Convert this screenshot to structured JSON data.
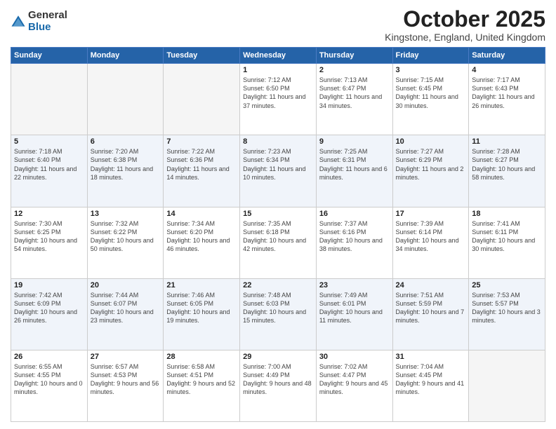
{
  "header": {
    "logo_general": "General",
    "logo_blue": "Blue",
    "title": "October 2025",
    "location": "Kingstone, England, United Kingdom"
  },
  "days_of_week": [
    "Sunday",
    "Monday",
    "Tuesday",
    "Wednesday",
    "Thursday",
    "Friday",
    "Saturday"
  ],
  "weeks": [
    [
      {
        "day": "",
        "empty": true
      },
      {
        "day": "",
        "empty": true
      },
      {
        "day": "",
        "empty": true
      },
      {
        "day": "1",
        "sunrise": "7:12 AM",
        "sunset": "6:50 PM",
        "daylight": "11 hours and 37 minutes."
      },
      {
        "day": "2",
        "sunrise": "7:13 AM",
        "sunset": "6:47 PM",
        "daylight": "11 hours and 34 minutes."
      },
      {
        "day": "3",
        "sunrise": "7:15 AM",
        "sunset": "6:45 PM",
        "daylight": "11 hours and 30 minutes."
      },
      {
        "day": "4",
        "sunrise": "7:17 AM",
        "sunset": "6:43 PM",
        "daylight": "11 hours and 26 minutes."
      }
    ],
    [
      {
        "day": "5",
        "sunrise": "7:18 AM",
        "sunset": "6:40 PM",
        "daylight": "11 hours and 22 minutes."
      },
      {
        "day": "6",
        "sunrise": "7:20 AM",
        "sunset": "6:38 PM",
        "daylight": "11 hours and 18 minutes."
      },
      {
        "day": "7",
        "sunrise": "7:22 AM",
        "sunset": "6:36 PM",
        "daylight": "11 hours and 14 minutes."
      },
      {
        "day": "8",
        "sunrise": "7:23 AM",
        "sunset": "6:34 PM",
        "daylight": "11 hours and 10 minutes."
      },
      {
        "day": "9",
        "sunrise": "7:25 AM",
        "sunset": "6:31 PM",
        "daylight": "11 hours and 6 minutes."
      },
      {
        "day": "10",
        "sunrise": "7:27 AM",
        "sunset": "6:29 PM",
        "daylight": "11 hours and 2 minutes."
      },
      {
        "day": "11",
        "sunrise": "7:28 AM",
        "sunset": "6:27 PM",
        "daylight": "10 hours and 58 minutes."
      }
    ],
    [
      {
        "day": "12",
        "sunrise": "7:30 AM",
        "sunset": "6:25 PM",
        "daylight": "10 hours and 54 minutes."
      },
      {
        "day": "13",
        "sunrise": "7:32 AM",
        "sunset": "6:22 PM",
        "daylight": "10 hours and 50 minutes."
      },
      {
        "day": "14",
        "sunrise": "7:34 AM",
        "sunset": "6:20 PM",
        "daylight": "10 hours and 46 minutes."
      },
      {
        "day": "15",
        "sunrise": "7:35 AM",
        "sunset": "6:18 PM",
        "daylight": "10 hours and 42 minutes."
      },
      {
        "day": "16",
        "sunrise": "7:37 AM",
        "sunset": "6:16 PM",
        "daylight": "10 hours and 38 minutes."
      },
      {
        "day": "17",
        "sunrise": "7:39 AM",
        "sunset": "6:14 PM",
        "daylight": "10 hours and 34 minutes."
      },
      {
        "day": "18",
        "sunrise": "7:41 AM",
        "sunset": "6:11 PM",
        "daylight": "10 hours and 30 minutes."
      }
    ],
    [
      {
        "day": "19",
        "sunrise": "7:42 AM",
        "sunset": "6:09 PM",
        "daylight": "10 hours and 26 minutes."
      },
      {
        "day": "20",
        "sunrise": "7:44 AM",
        "sunset": "6:07 PM",
        "daylight": "10 hours and 23 minutes."
      },
      {
        "day": "21",
        "sunrise": "7:46 AM",
        "sunset": "6:05 PM",
        "daylight": "10 hours and 19 minutes."
      },
      {
        "day": "22",
        "sunrise": "7:48 AM",
        "sunset": "6:03 PM",
        "daylight": "10 hours and 15 minutes."
      },
      {
        "day": "23",
        "sunrise": "7:49 AM",
        "sunset": "6:01 PM",
        "daylight": "10 hours and 11 minutes."
      },
      {
        "day": "24",
        "sunrise": "7:51 AM",
        "sunset": "5:59 PM",
        "daylight": "10 hours and 7 minutes."
      },
      {
        "day": "25",
        "sunrise": "7:53 AM",
        "sunset": "5:57 PM",
        "daylight": "10 hours and 3 minutes."
      }
    ],
    [
      {
        "day": "26",
        "sunrise": "6:55 AM",
        "sunset": "4:55 PM",
        "daylight": "10 hours and 0 minutes."
      },
      {
        "day": "27",
        "sunrise": "6:57 AM",
        "sunset": "4:53 PM",
        "daylight": "9 hours and 56 minutes."
      },
      {
        "day": "28",
        "sunrise": "6:58 AM",
        "sunset": "4:51 PM",
        "daylight": "9 hours and 52 minutes."
      },
      {
        "day": "29",
        "sunrise": "7:00 AM",
        "sunset": "4:49 PM",
        "daylight": "9 hours and 48 minutes."
      },
      {
        "day": "30",
        "sunrise": "7:02 AM",
        "sunset": "4:47 PM",
        "daylight": "9 hours and 45 minutes."
      },
      {
        "day": "31",
        "sunrise": "7:04 AM",
        "sunset": "4:45 PM",
        "daylight": "9 hours and 41 minutes."
      },
      {
        "day": "",
        "empty": true
      }
    ]
  ]
}
